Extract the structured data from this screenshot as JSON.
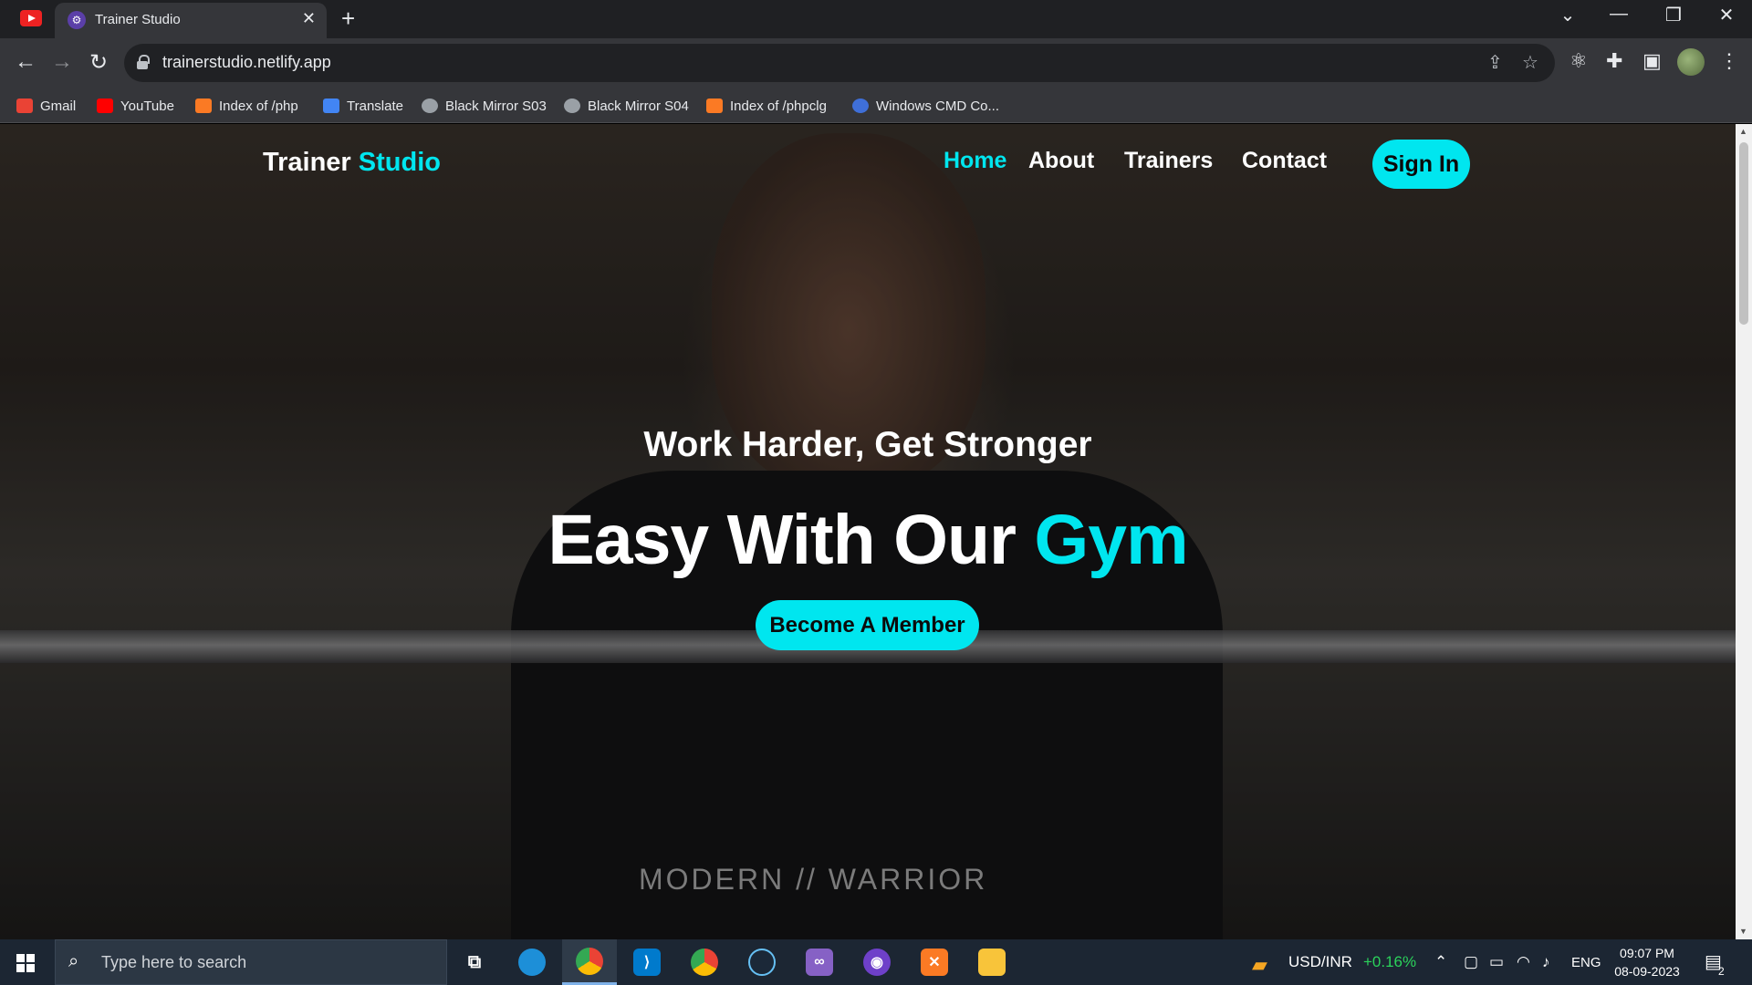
{
  "browser": {
    "tab_title": "Trainer Studio",
    "url": "trainerstudio.netlify.app",
    "bookmarks": [
      {
        "label": "Gmail",
        "icon": "gmail-icon",
        "color": "#ea4335"
      },
      {
        "label": "YouTube",
        "icon": "youtube-icon",
        "color": "#ff0000"
      },
      {
        "label": "Index of /php",
        "icon": "xampp-icon",
        "color": "#fb7a24"
      },
      {
        "label": "Translate",
        "icon": "translate-icon",
        "color": "#4285f4"
      },
      {
        "label": "Black Mirror S03",
        "icon": "globe-icon",
        "color": "#9aa0a6"
      },
      {
        "label": "Black Mirror S04",
        "icon": "globe-icon",
        "color": "#9aa0a6"
      },
      {
        "label": "Index of /phpclg",
        "icon": "xampp-icon",
        "color": "#fb7a24"
      },
      {
        "label": "Windows CMD Co...",
        "icon": "site-icon",
        "color": "#3f6fd8"
      }
    ]
  },
  "site": {
    "logo_main": "Trainer",
    "logo_accent": "Studio",
    "nav": {
      "home": "Home",
      "about": "About",
      "trainers": "Trainers",
      "contact": "Contact"
    },
    "sign_in": "Sign In",
    "hero_subtitle": "Work Harder, Get Stronger",
    "hero_title_main": "Easy With Our",
    "hero_title_accent": "Gym",
    "cta": "Become A Member",
    "shirt_print": "MODERN // WARRIOR",
    "accent_color": "#00e6ef"
  },
  "taskbar": {
    "search_placeholder": "Type here to search",
    "ticker_label": "USD/INR",
    "ticker_change": "+0.16%",
    "language": "ENG",
    "time": "09:07 PM",
    "date": "08-09-2023",
    "notification_count": "2"
  }
}
